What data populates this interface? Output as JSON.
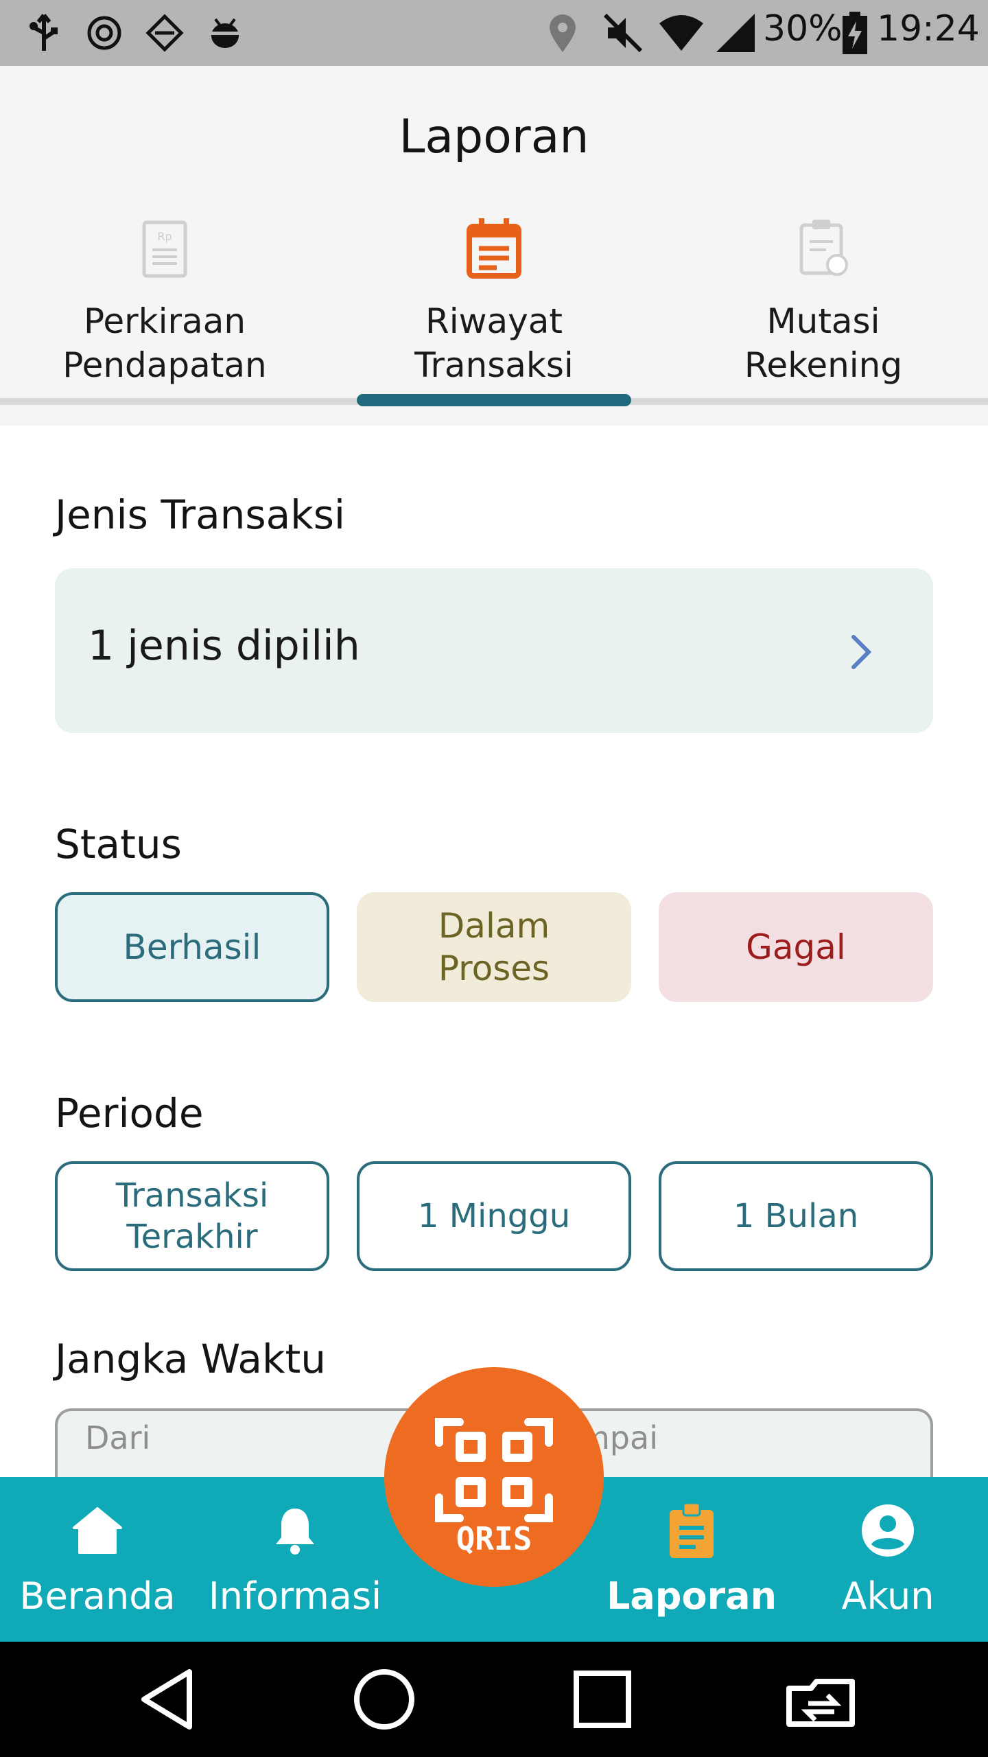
{
  "status_bar": {
    "battery": "30%",
    "time": "19:24",
    "icons": [
      "usb-icon",
      "settings-gear-icon",
      "gallery-icon",
      "android-debug-icon",
      "location-icon",
      "mute-icon",
      "wifi-icon",
      "signal-icon",
      "battery-charging-icon"
    ]
  },
  "header": {
    "title": "Laporan",
    "tabs": [
      {
        "label": "Perkiraan\nPendapatan",
        "icon": "invoice-rp-icon",
        "active": false
      },
      {
        "label": "Riwayat\nTransaksi",
        "icon": "calendar-list-icon",
        "active": true
      },
      {
        "label": "Mutasi\nRekening",
        "icon": "clipboard-transfer-icon",
        "active": false
      }
    ]
  },
  "jenis": {
    "label": "Jenis Transaksi",
    "value": "1 jenis dipilih"
  },
  "status": {
    "label": "Status",
    "chips": [
      "Berhasil",
      "Dalam\nProses",
      "Gagal"
    ]
  },
  "periode": {
    "label": "Periode",
    "chips": [
      "Transaksi\nTerakhir",
      "1 Minggu",
      "1 Bulan"
    ]
  },
  "jangka": {
    "label": "Jangka Waktu",
    "from_placeholder": "Dari",
    "to_placeholder": "mpai"
  },
  "bottom_nav": {
    "items": [
      {
        "label": "Beranda",
        "icon": "home-icon"
      },
      {
        "label": "Informasi",
        "icon": "bell-icon"
      },
      {
        "label": "Laporan",
        "icon": "report-clipboard-icon",
        "active": true
      },
      {
        "label": "Akun",
        "icon": "account-icon"
      }
    ],
    "qris_label": "QRIS"
  },
  "colors": {
    "accent_teal": "#1f6b7d",
    "nav_bg": "#0fa9b8",
    "qris_orange": "#ee6b22",
    "active_icon_orange": "#f4a335"
  }
}
